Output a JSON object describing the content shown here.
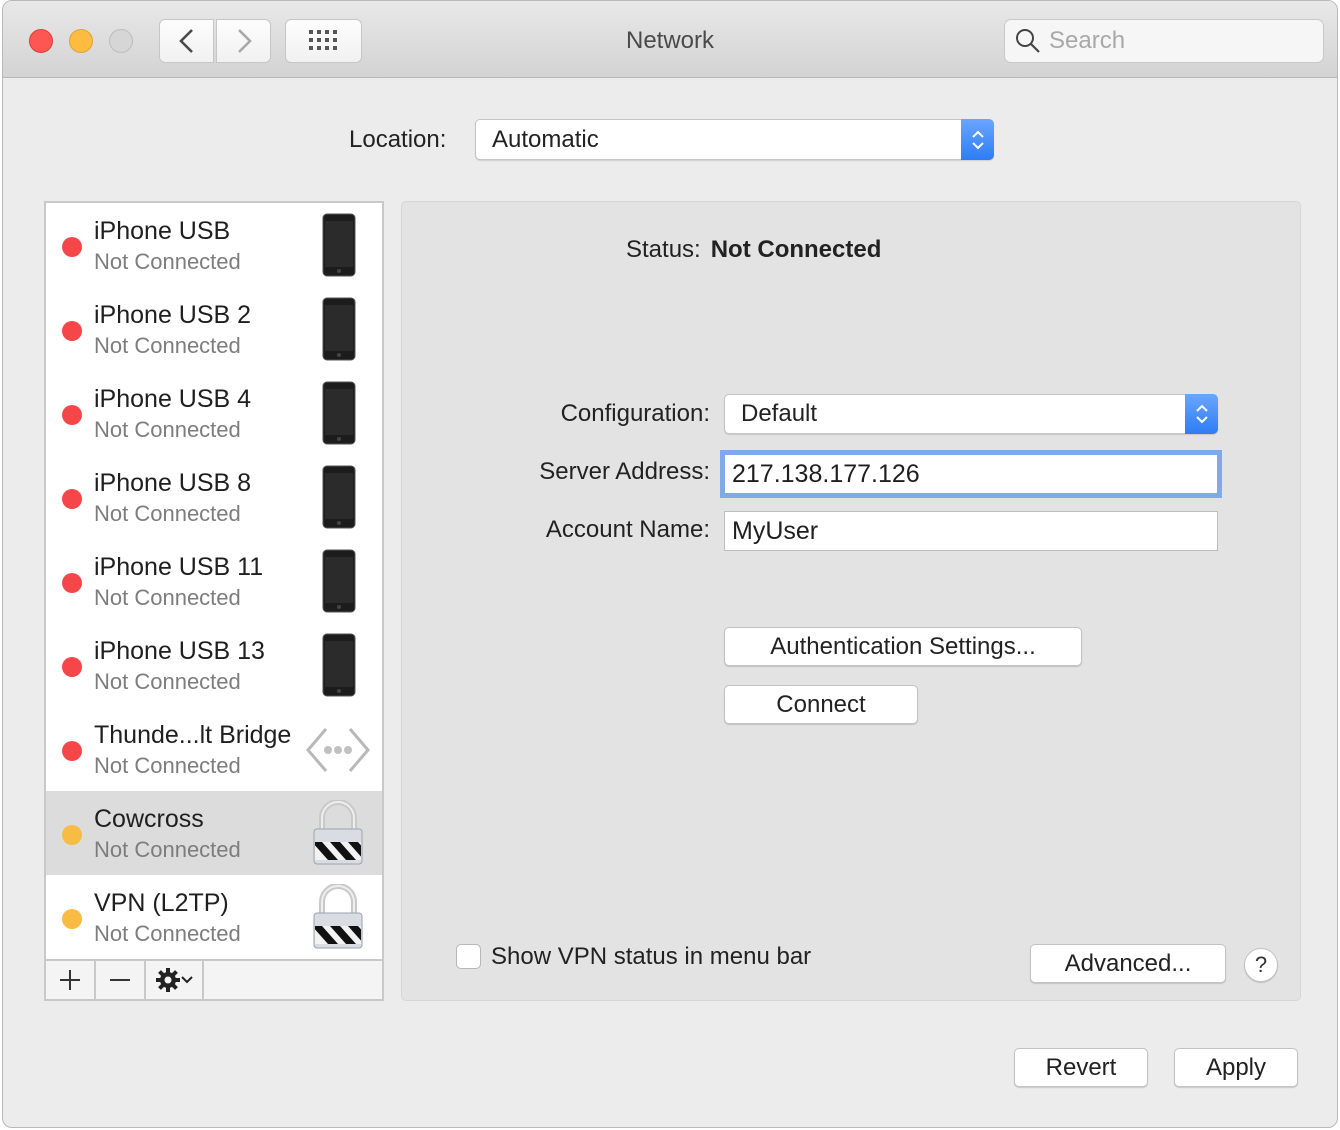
{
  "window": {
    "title": "Network",
    "search_placeholder": "Search"
  },
  "location": {
    "label": "Location:",
    "value": "Automatic"
  },
  "services": [
    {
      "name": "iPhone USB",
      "status": "Not Connected",
      "dot_color": "#f5474a",
      "icon": "iphone-icon",
      "selected": false
    },
    {
      "name": "iPhone USB 2",
      "status": "Not Connected",
      "dot_color": "#f5474a",
      "icon": "iphone-icon",
      "selected": false
    },
    {
      "name": "iPhone USB 4",
      "status": "Not Connected",
      "dot_color": "#f5474a",
      "icon": "iphone-icon",
      "selected": false
    },
    {
      "name": "iPhone USB 8",
      "status": "Not Connected",
      "dot_color": "#f5474a",
      "icon": "iphone-icon",
      "selected": false
    },
    {
      "name": "iPhone USB 11",
      "status": "Not Connected",
      "dot_color": "#f5474a",
      "icon": "iphone-icon",
      "selected": false
    },
    {
      "name": "iPhone USB 13",
      "status": "Not Connected",
      "dot_color": "#f5474a",
      "icon": "iphone-icon",
      "selected": false
    },
    {
      "name": "Thunde...lt Bridge",
      "status": "Not Connected",
      "dot_color": "#f5474a",
      "icon": "thunderbolt-bridge-icon",
      "selected": false
    },
    {
      "name": "Cowcross",
      "status": "Not Connected",
      "dot_color": "#f8bb43",
      "icon": "vpn-lock-icon",
      "selected": true
    },
    {
      "name": "VPN (L2TP)",
      "status": "Not Connected",
      "dot_color": "#f8bb43",
      "icon": "vpn-lock-icon",
      "selected": false
    }
  ],
  "sidebar_footer": {
    "add": "+",
    "remove": "—"
  },
  "detail": {
    "status_label": "Status:",
    "status_value": "Not Connected",
    "configuration_label": "Configuration:",
    "configuration_value": "Default",
    "server_address_label": "Server Address:",
    "server_address_value": "217.138.177.126",
    "account_name_label": "Account Name:",
    "account_name_value": "MyUser",
    "auth_button": "Authentication Settings...",
    "connect_button": "Connect",
    "show_vpn_status_label": "Show VPN status in menu bar",
    "show_vpn_status_checked": false,
    "advanced_button": "Advanced...",
    "help_button": "?"
  },
  "footer": {
    "revert": "Revert",
    "apply": "Apply"
  },
  "colors": {
    "accent": "#2e7cf6",
    "focus_ring": "#7fa9ea",
    "status_red": "#f5474a",
    "status_yellow": "#f8bb43"
  }
}
